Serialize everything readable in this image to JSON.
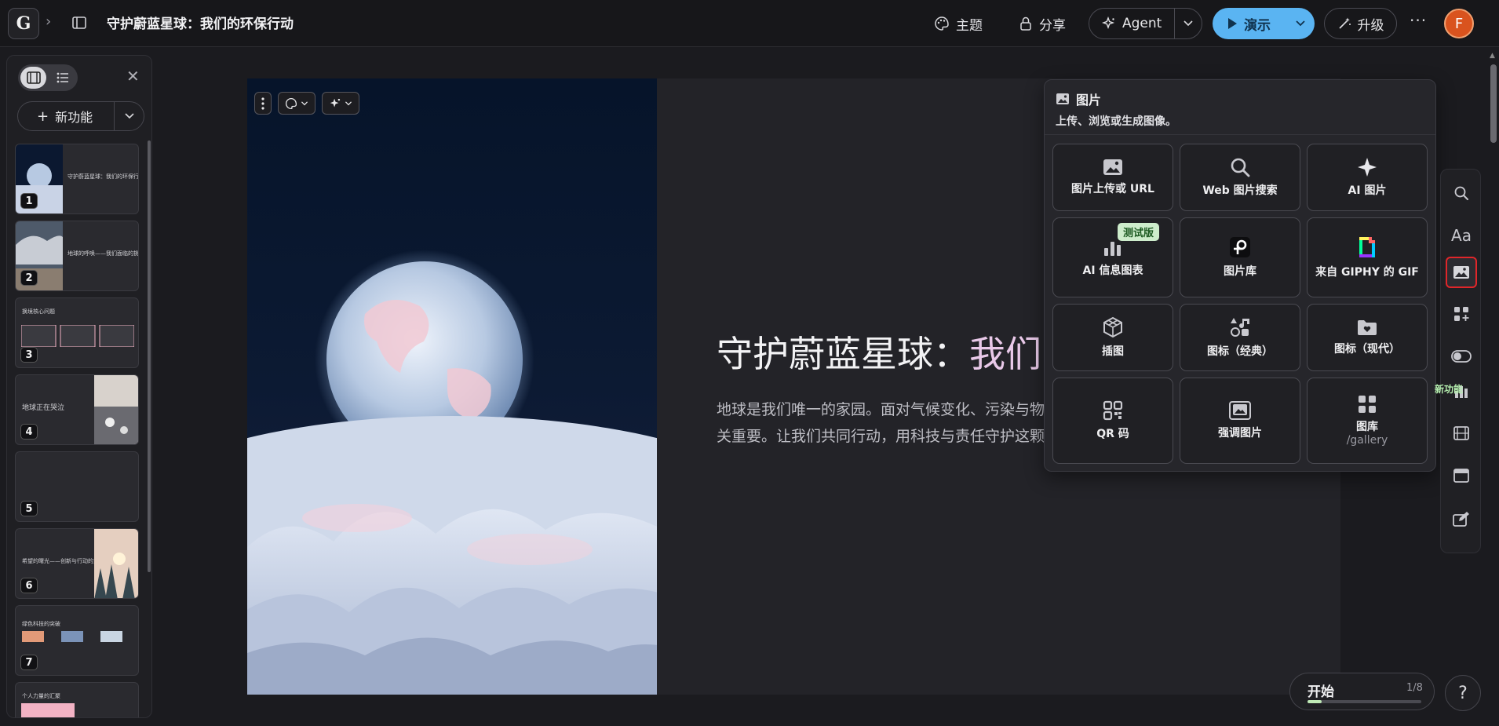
{
  "app": {
    "logo_letter": "G",
    "doc_title": "守护蔚蓝星球：我们的环保行动"
  },
  "toolbar": {
    "theme_label": "主题",
    "share_label": "分享",
    "agent_label": "Agent",
    "present_label": "演示",
    "upgrade_label": "升级",
    "more_label": "···",
    "avatar_initial": "F"
  },
  "left_panel": {
    "new_feature_label": "新功能",
    "slides": [
      {
        "num": "1",
        "title": "守护蔚蓝星球：我们的环保行动"
      },
      {
        "num": "2",
        "title": "地球的呼唤——我们面临的挑战"
      },
      {
        "num": "3",
        "title": "换境核心问题"
      },
      {
        "num": "4",
        "title": "地球正在哭泣"
      },
      {
        "num": "5",
        "title": ""
      },
      {
        "num": "6",
        "title": "希望的曙光——创新与行动的力量"
      },
      {
        "num": "7",
        "title": "绿色科技的突破"
      },
      {
        "num": "8",
        "title": "个人力量的汇聚"
      }
    ]
  },
  "slide": {
    "title_main": "守护蔚蓝星球：",
    "title_accent": "我们",
    "body_line1": "地球是我们唯一的家园。面对气候变化、污染与物",
    "body_line2": "关重要。让我们共同行动，用科技与责任守护这颗"
  },
  "image_popover": {
    "title": "图片",
    "subtitle": "上传、浏览或生成图像。",
    "beta_badge": "测试版",
    "items": [
      {
        "label": "图片上传或 URL",
        "icon": "image-upload-icon"
      },
      {
        "label": "Web 图片搜索",
        "icon": "search-icon"
      },
      {
        "label": "AI 图片",
        "icon": "sparkle-icon"
      },
      {
        "label": "AI 信息图表",
        "icon": "bar-chart-icon"
      },
      {
        "label": "图片库",
        "icon": "stock-library-icon"
      },
      {
        "label": "来自 GIPHY 的 GIF",
        "icon": "giphy-icon"
      },
      {
        "label": "插图",
        "icon": "illustration-icon"
      },
      {
        "label": "图标（经典）",
        "icon": "classic-icons-icon"
      },
      {
        "label": "图标（现代）",
        "icon": "modern-icons-icon"
      },
      {
        "label": "QR 码",
        "icon": "qr-code-icon"
      },
      {
        "label": "强调图片",
        "icon": "accent-image-icon"
      },
      {
        "label": "图库",
        "sub": "/gallery",
        "icon": "gallery-icon"
      }
    ]
  },
  "right_toolbar": {
    "new_label": "新功能",
    "items": [
      "search-icon",
      "text-style-icon",
      "image-icon",
      "blocks-add-icon",
      "toggle-icon",
      "chart-icon",
      "video-icon",
      "embed-icon",
      "edit-icon"
    ]
  },
  "progress": {
    "start_label": "开始",
    "count": "1/8",
    "fraction": 0.125
  },
  "help_label": "?",
  "colors": {
    "accent_blue": "#5ab4f2",
    "active_red": "#e0262a",
    "beta_green": "#cdeccb",
    "avatar_orange": "#d9531e"
  }
}
